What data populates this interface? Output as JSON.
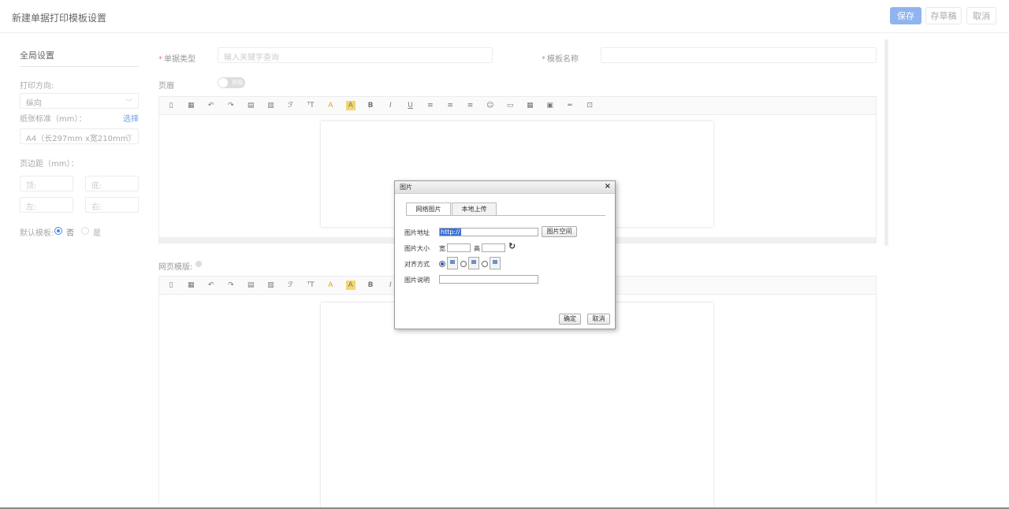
{
  "header": {
    "title": "新建单据打印模板设置",
    "save": "保存",
    "draft": "存草稿",
    "cancel": "取消"
  },
  "sidebar": {
    "title": "全局设置",
    "orientation_label": "打印方向:",
    "orientation_value": "纵向",
    "paper_label": "纸张标准（mm）：",
    "paper_pick": "选择",
    "paper_value": "A4（长297mm x宽210mm）",
    "margin_label": "页边距（mm）：",
    "margin_top": "顶:",
    "margin_bottom": "底:",
    "margin_left": "左:",
    "margin_right": "右:",
    "default_label": "默认模板:",
    "default_no": "否",
    "default_yes": "是"
  },
  "form": {
    "doc_type_label": "单据类型",
    "doc_type_placeholder": "输入关键字查询",
    "template_name_label": "模板名称",
    "header_label": "页眉",
    "toggle_text": "停用",
    "webpage_label": "网页模版:"
  },
  "dialog": {
    "title": "图片",
    "close": "×",
    "tab_network": "网络图片",
    "tab_local": "本地上传",
    "url_label": "图片地址",
    "url_value": "http://",
    "image_space": "图片空间",
    "size_label": "图片大小",
    "width_label": "宽",
    "height_label": "高",
    "refresh": "↻",
    "align_label": "对齐方式",
    "desc_label": "图片说明",
    "ok": "确定",
    "cancel": "取消"
  }
}
